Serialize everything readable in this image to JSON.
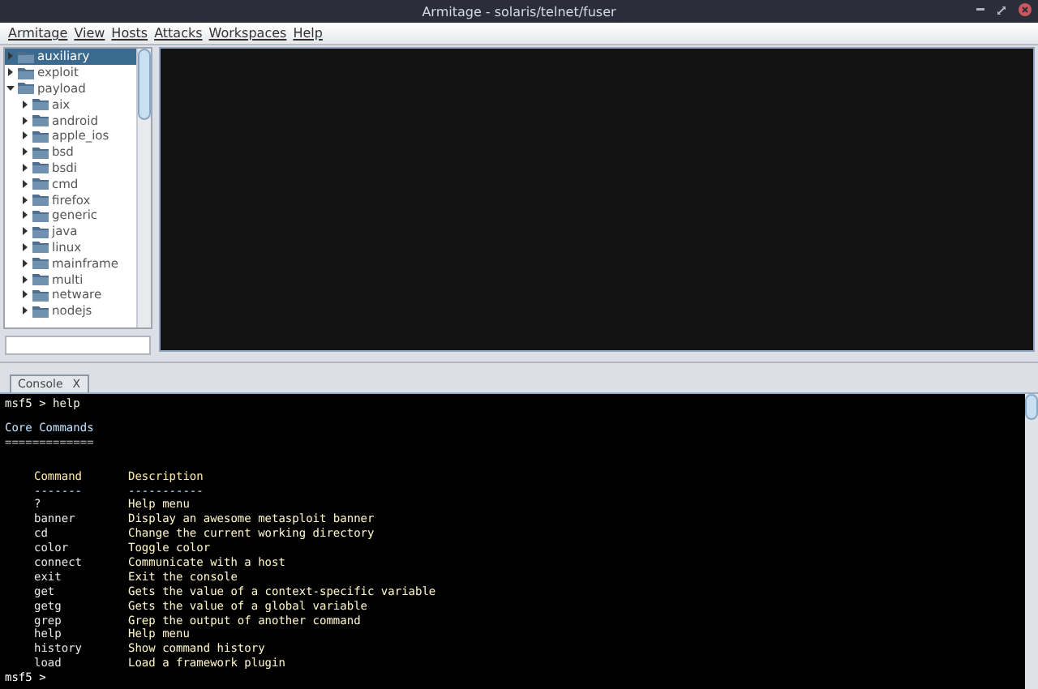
{
  "window": {
    "title": "Armitage - solaris/telnet/fuser"
  },
  "menu": [
    "Armitage",
    "View",
    "Hosts",
    "Attacks",
    "Workspaces",
    "Help"
  ],
  "tree": [
    {
      "label": "auxiliary",
      "selected": true,
      "expanded": false
    },
    {
      "label": "exploit",
      "selected": false,
      "expanded": false
    },
    {
      "label": "payload",
      "selected": false,
      "expanded": true,
      "children": [
        {
          "label": "aix",
          "selected": false,
          "expanded": false
        },
        {
          "label": "android",
          "selected": false,
          "expanded": false
        },
        {
          "label": "apple_ios",
          "selected": false,
          "expanded": false
        },
        {
          "label": "bsd",
          "selected": false,
          "expanded": false
        },
        {
          "label": "bsdi",
          "selected": false,
          "expanded": false
        },
        {
          "label": "cmd",
          "selected": false,
          "expanded": false
        },
        {
          "label": "firefox",
          "selected": false,
          "expanded": false
        },
        {
          "label": "generic",
          "selected": false,
          "expanded": false
        },
        {
          "label": "java",
          "selected": false,
          "expanded": false
        },
        {
          "label": "linux",
          "selected": false,
          "expanded": false
        },
        {
          "label": "mainframe",
          "selected": false,
          "expanded": false
        },
        {
          "label": "multi",
          "selected": false,
          "expanded": false
        },
        {
          "label": "netware",
          "selected": false,
          "expanded": false
        },
        {
          "label": "nodejs",
          "selected": false,
          "expanded": false
        }
      ]
    }
  ],
  "tabs": [
    {
      "label": "Console",
      "close": "X",
      "selected": true
    }
  ],
  "console": {
    "lines": [
      {
        "kind": "prompt",
        "text": "msf5 > help"
      },
      {
        "kind": "blank"
      },
      {
        "kind": "heading",
        "text": "Core Commands"
      },
      {
        "kind": "rule",
        "text": "============="
      },
      {
        "kind": "blank"
      }
    ],
    "columns": [
      "Command",
      "Description"
    ],
    "column_rules": [
      "-------",
      "-----------"
    ],
    "rows": [
      {
        "command": "?",
        "description": "Help menu"
      },
      {
        "command": "banner",
        "description": "Display an awesome metasploit banner"
      },
      {
        "command": "cd",
        "description": "Change the current working directory"
      },
      {
        "command": "color",
        "description": "Toggle color"
      },
      {
        "command": "connect",
        "description": "Communicate with a host"
      },
      {
        "command": "exit",
        "description": "Exit the console"
      },
      {
        "command": "get",
        "description": "Gets the value of a context-specific variable"
      },
      {
        "command": "getg",
        "description": "Gets the value of a global variable"
      },
      {
        "command": "grep",
        "description": "Grep the output of another command"
      },
      {
        "command": "help",
        "description": "Help menu"
      },
      {
        "command": "history",
        "description": "Show command history"
      },
      {
        "command": "load",
        "description": "Load a framework plugin"
      }
    ],
    "input_prompt": "msf5 >"
  }
}
